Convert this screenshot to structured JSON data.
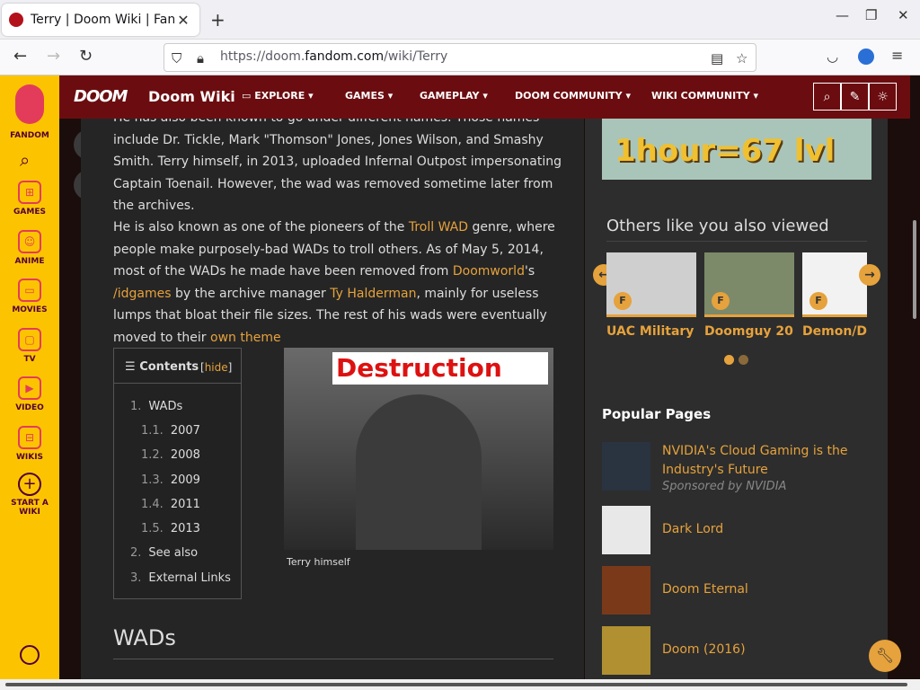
{
  "browser": {
    "tab_title": "Terry | Doom Wiki | Fandom",
    "url_prefix": "https://doom.",
    "url_domain": "fandom.com",
    "url_path": "/wiki/Terry"
  },
  "rail": {
    "brand": "FANDOM",
    "items": [
      {
        "label": "GAMES"
      },
      {
        "label": "ANIME"
      },
      {
        "label": "MOVIES"
      },
      {
        "label": "TV"
      },
      {
        "label": "VIDEO"
      },
      {
        "label": "WIKIS"
      },
      {
        "label": "START A WIKI"
      }
    ]
  },
  "header": {
    "logo": "DOOM",
    "wiki_name": "Doom Wiki",
    "menu": [
      "EXPLORE",
      "GAMES",
      "GAMEPLAY",
      "DOOM COMMUNITY",
      "WIKI COMMUNITY"
    ]
  },
  "article": {
    "p1": "He has also been known to go under different names. Those names include Dr. Tickle, Mark \"Thomson\" Jones, Jones Wilson, and Smashy Smith. Terry himself, in 2013, uploaded Infernal Outpost impersonating Captain Toenail. However, the wad was removed sometime later from the archives.",
    "p2_a": "He is also known as one of the pioneers of the ",
    "p2_link1": "Troll WAD",
    "p2_b": " genre, where people make purposely-bad WADs to troll others. As of May 5, 2014, most of the WADs he made have been removed from ",
    "p2_link2": "Doomworld",
    "p2_c": "'s ",
    "p2_link3": "/idgames",
    "p2_d": " by the archive manager ",
    "p2_link4": "Ty Halderman",
    "p2_e": ", mainly for useless lumps that bloat their file sizes. The rest of his wads were eventually moved to their ",
    "p2_link5": "own theme",
    "toc_title": "Contents",
    "toc_hide": "hide",
    "toc": [
      {
        "num": "1.",
        "text": "WADs"
      },
      {
        "num": "1.1.",
        "text": "2007"
      },
      {
        "num": "1.2.",
        "text": "2008"
      },
      {
        "num": "1.3.",
        "text": "2009"
      },
      {
        "num": "1.4.",
        "text": "2011"
      },
      {
        "num": "1.5.",
        "text": "2013"
      },
      {
        "num": "2.",
        "text": "See also"
      },
      {
        "num": "3.",
        "text": "External Links"
      }
    ],
    "figure_banner": "Destruction",
    "figure_caption": "Terry himself",
    "section_heading": "WADs"
  },
  "sidebar": {
    "ad_text": "1hour=67 lvl",
    "others_heading": "Others like you also viewed",
    "cards": [
      {
        "label": "UAC Military ..."
      },
      {
        "label": "Doomguy 20..."
      },
      {
        "label": "Demon/Do"
      }
    ],
    "popular_heading": "Popular Pages",
    "popular": [
      {
        "title": "NVIDIA's Cloud Gaming is the Industry's Future",
        "sponsor": "Sponsored by NVIDIA"
      },
      {
        "title": "Dark Lord",
        "sponsor": ""
      },
      {
        "title": "Doom Eternal",
        "sponsor": ""
      },
      {
        "title": "Doom (2016)",
        "sponsor": ""
      }
    ]
  },
  "colors": {
    "accent": "#e6a23c",
    "header": "#6b0d10",
    "rail": "#fcc400"
  }
}
